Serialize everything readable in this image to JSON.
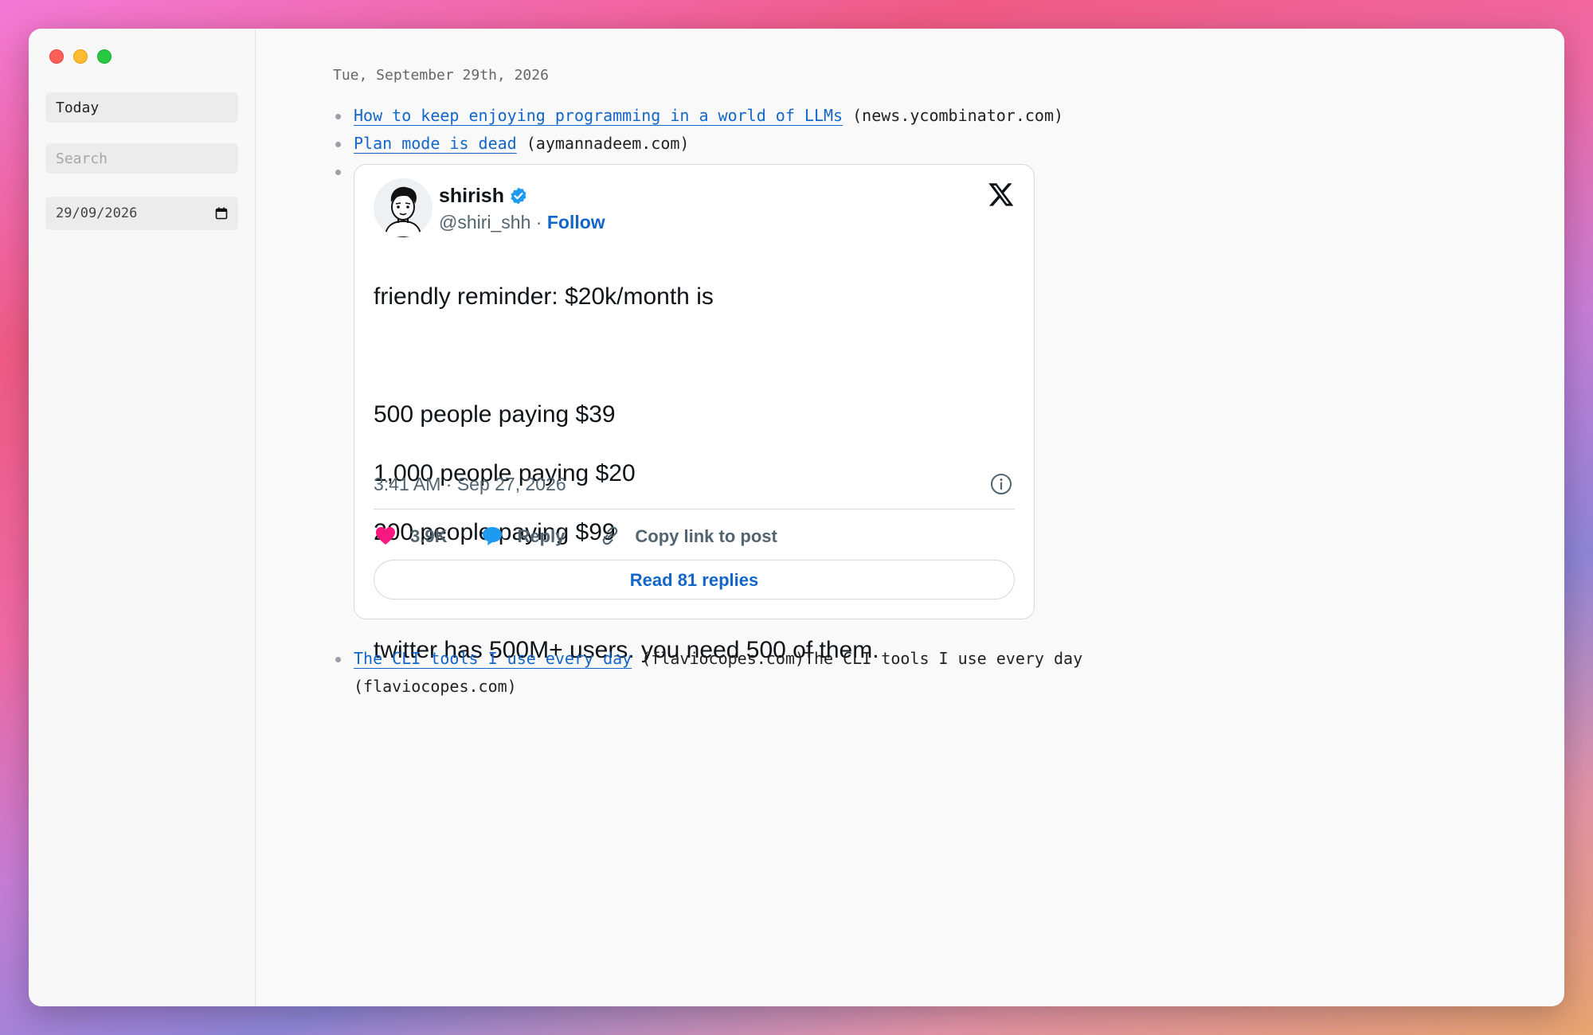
{
  "window": {
    "controls": [
      "close",
      "minimize",
      "zoom"
    ]
  },
  "sidebar": {
    "today_label": "Today",
    "search_placeholder": "Search",
    "date_value": "29/09/2026",
    "date_icon": "calendar-icon"
  },
  "main": {
    "date_heading": "Tue, September 29th, 2026",
    "entries": [
      {
        "title": "How to keep enjoying programming in a world of LLMs",
        "source": "(news.ycombinator.com)"
      },
      {
        "title": "Plan mode is dead",
        "source": "(aymannadeem.com)"
      },
      {
        "title": "The CLI tools I use every day",
        "source": "(flaviocopes.com)The CLI tools I use every day (flaviocopes.com)"
      }
    ],
    "tweet": {
      "name": "shirish",
      "handle": "@shiri_shh",
      "separator": "·",
      "follow_label": "Follow",
      "text": {
        "line1": "friendly reminder: $20k/month is",
        "line2": "500 people paying $39",
        "line3": "1,000 people paying $20",
        "line4": "200 people paying $99",
        "line5": "twitter has 500M+ users. you need 500 of them."
      },
      "timestamp": "3:41 AM · Sep 27, 2026",
      "likes": "3.9K",
      "reply_label": "Reply",
      "copy_label": "Copy link to post",
      "read_replies_label": "Read 81 replies",
      "colors": {
        "link": "#1266c9",
        "heart": "#f91880",
        "reply_bubble": "#1d9bf0",
        "verified": "#1d9bf0"
      }
    }
  }
}
